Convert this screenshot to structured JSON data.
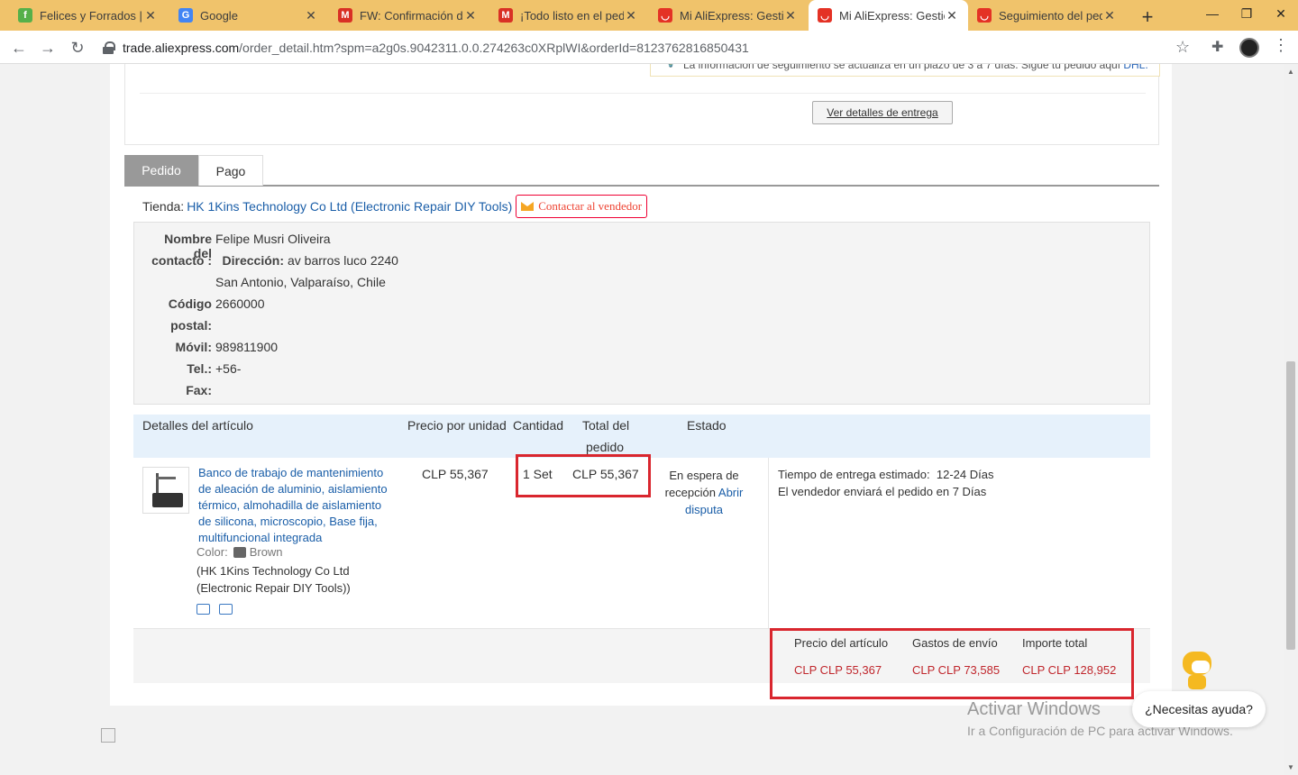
{
  "browser": {
    "tabs": [
      {
        "title": "Felices y Forrados | Ed",
        "icon": "leaf-icon",
        "color": "#56b04a",
        "glyph": "f"
      },
      {
        "title": "Google",
        "icon": "google-icon",
        "color": "#4285f4",
        "glyph": "G"
      },
      {
        "title": "FW: Confirmación de",
        "icon": "gmail-icon",
        "color": "#d93025",
        "glyph": "M"
      },
      {
        "title": "¡Todo listo en el pedi",
        "icon": "gmail-icon",
        "color": "#d93025",
        "glyph": "M"
      },
      {
        "title": "Mi AliExpress: Gestio",
        "icon": "aliexpress-icon",
        "color": "#e43225",
        "glyph": "◡"
      },
      {
        "title": "Mi AliExpress: Gestio",
        "icon": "aliexpress-icon",
        "color": "#e43225",
        "glyph": "◡",
        "active": true
      },
      {
        "title": "Seguimiento del ped",
        "icon": "aliexpress-icon",
        "color": "#e43225",
        "glyph": "◡"
      }
    ],
    "url_host": "trade.aliexpress.com",
    "url_path": "/order_detail.htm?spm=a2g0s.9042311.0.0.274263c0XRplWI&orderId=8123762816850431"
  },
  "tracking": {
    "notice": "La información de seguimiento se actualiza en un plazo de 3 a 7 días. Sigue tu pedido aquí",
    "notice_link": "DHL.",
    "details_button": "Ver detalles de entrega"
  },
  "order_tabs": {
    "order": "Pedido",
    "payment": "Pago"
  },
  "store": {
    "label": "Tienda:",
    "name": "HK 1Kins Technology Co Ltd (Electronic Repair DIY Tools)",
    "contact_button": "Contactar al vendedor"
  },
  "address": {
    "contact_label_1": "Nombre del",
    "contact_label_2": "contacto :",
    "contact_value": "Felipe Musri Oliveira",
    "direccion_label": "Dirección:",
    "direccion_value": "av barros luco 2240",
    "city": "San Antonio, Valparaíso, Chile",
    "postal_label_1": "Código",
    "postal_label_2": "postal:",
    "postal_value": "2660000",
    "mobile_label": "Móvil:",
    "mobile_value": "989811900",
    "tel_label": "Tel.:",
    "tel_value": "+56-",
    "fax_label": "Fax:"
  },
  "items_header": {
    "details": "Detalles del artículo",
    "unit_price": "Precio por unidad",
    "quantity": "Cantidad",
    "total_1": "Total del",
    "total_2": "pedido",
    "status": "Estado"
  },
  "item": {
    "title": "Banco de trabajo de mantenimiento de aleación de aluminio, aislamiento térmico, almohadilla de aislamiento de silicona, microscopio, Base fija, multifuncional integrada",
    "color_label": "Color:",
    "color_value": "Brown",
    "seller": "(HK 1Kins Technology Co Ltd (Electronic Repair DIY Tools))",
    "unit_price": "CLP 55,367",
    "quantity": "1 Set",
    "total": "CLP 55,367",
    "status_1": "En espera de",
    "status_2": "recepción",
    "dispute": "Abrir disputa",
    "delivery_time_label": "Tiempo de entrega estimado:",
    "delivery_time_value": "12-24 Días",
    "ship_note": "El vendedor enviará el pedido en 7 Días"
  },
  "totals": {
    "item_price_label": "Precio del artículo",
    "item_price_value": "CLP CLP 55,367",
    "shipping_label": "Gastos de envío",
    "shipping_value": "CLP CLP 73,585",
    "total_label": "Importe total",
    "total_value": "CLP CLP 128,952"
  },
  "windows": {
    "watermark_title": "Activar Windows",
    "watermark_sub": "Ir a Configuración de PC para activar Windows."
  },
  "help": {
    "label": "¿Necesitas ayuda?"
  },
  "colors": {
    "accent_red": "#d9262e",
    "link_blue": "#1a5ea8",
    "tabbar": "#f0c36b",
    "price_red": "#c0272d"
  }
}
